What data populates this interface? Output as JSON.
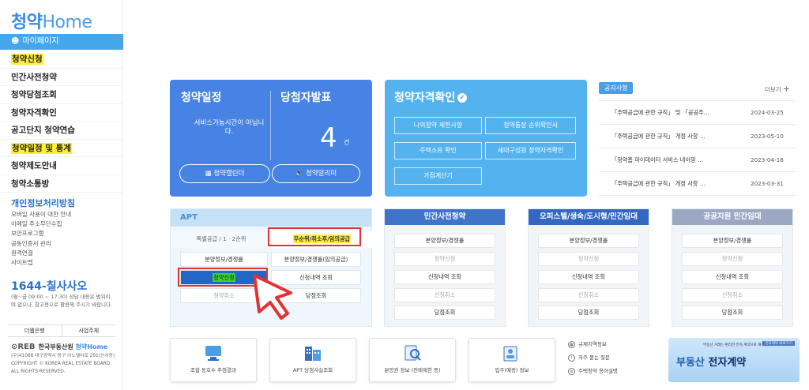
{
  "logo": {
    "main": "청약",
    "home": "Home"
  },
  "mypage_label": "마이페이지",
  "menu": [
    {
      "label": "청약신청",
      "highlight": true
    },
    {
      "label": "민간사전청약",
      "highlight": false
    },
    {
      "label": "청약당첨조회",
      "highlight": false
    },
    {
      "label": "청약자격확인",
      "highlight": false
    },
    {
      "label": "공고단지 청약연습",
      "highlight": false
    },
    {
      "label": "청약일정 및 통계",
      "highlight": true
    },
    {
      "label": "청약제도안내",
      "highlight": false
    },
    {
      "label": "청약소통방",
      "highlight": false
    }
  ],
  "privacy": "개인정보처리방침",
  "sublinks": [
    "모바일 사용이 대한 안내",
    "이메일 주소무단수집",
    "보안프로그램",
    "공동인증서 관리",
    "원격연결",
    "사이트맵"
  ],
  "phone": "1644-칠사사오",
  "hours": "(월~금 09:00 ~ 17:30) 상담 내용은 범위이며 없으나, 참고용으로 활용해 주시기 바랍니다.",
  "bank_links": [
    "더웹은행",
    "사업주체"
  ],
  "footer_logo": {
    "org": "한국부동산원",
    "brand_main": "청약",
    "brand_home": "Home"
  },
  "copyright": [
    "(우)41068 대구광역시 동구 이노밸리로 291(신서동)",
    "COPYRIGHT © KOREA REAL ESTATE BOARD.",
    "ALL RIGHTS RESERVED."
  ],
  "schedule_card": {
    "title_left": "청약일정",
    "title_right": "당첨자발표",
    "service_text": "서비스가능시간이 아닙니다.",
    "count": "4",
    "count_unit": "건",
    "btn_calendar": "청약캘린더",
    "btn_alarm": "청약알리미"
  },
  "qualify_card": {
    "title": "청약자격확인",
    "buttons": [
      "나의청약 제한사항",
      "청약통장 순위확인서",
      "주택소유 확인",
      "세대구성원 청약자격확인",
      "가점계산기"
    ]
  },
  "notice": {
    "tab": "공지사항",
    "more": "더보기",
    "rows": [
      {
        "title": "「주택공급에 관한 규칙」 및 「공공주…",
        "date": "2024-03-25"
      },
      {
        "title": "「주택공급에 관한 규칙」 개정 사항 …",
        "date": "2023-05-10"
      },
      {
        "title": "「청약홈 마이데이터 서비스 네이밍 …",
        "date": "2023-04-18"
      },
      {
        "title": "「주택공급에 관한 규칙」 개정 사항 …",
        "date": "2023-03-31"
      }
    ]
  },
  "apt": {
    "title": "APT",
    "tab1": "특별공급 / 1 · 2순위",
    "tab2": "무순위/취소후/임의공급",
    "buttons": [
      "분양정보/경쟁률",
      "분양정보/경쟁률(임의공급)",
      "청약신청",
      "신청내역 조회",
      "청약취소",
      "당첨조회"
    ]
  },
  "panels": [
    {
      "title": "민간사전청약",
      "buttons": [
        "분양정보/경쟁률",
        "청약신청",
        "신청내역 조회",
        "신청취소",
        "당첨조회"
      ]
    },
    {
      "title": "오피스텔/생숙/도시형/민간임대",
      "buttons": [
        "분양정보/경쟁률",
        "청약신청",
        "신청내역 조회",
        "신청취소",
        "당첨조회"
      ]
    },
    {
      "title": "공공지원 민간임대",
      "buttons": [
        "분양정보/경쟁률",
        "청약신청",
        "신청내역 조회",
        "신청취소",
        "당첨조회"
      ]
    }
  ],
  "tiles": [
    "조합 동호수 추첨결과",
    "APT 당첨사실조회",
    "분양권 정보 (전매제한 등)",
    "입주(예정) 정보"
  ],
  "tile_list": [
    "규제지역정보",
    "자주 묻는 질문",
    "주택청약 용어설명"
  ],
  "banner": {
    "title_a": "부동산",
    "title_b": "전자계약",
    "sub": "부동산 거래는 편리한 전자 계약으로 해주세요",
    "badge": "전자계약 바로가기"
  },
  "colors": {
    "primary": "#4683e3",
    "sky": "#54b3ef",
    "highlight": "#ffef3a",
    "red": "#e23232"
  }
}
